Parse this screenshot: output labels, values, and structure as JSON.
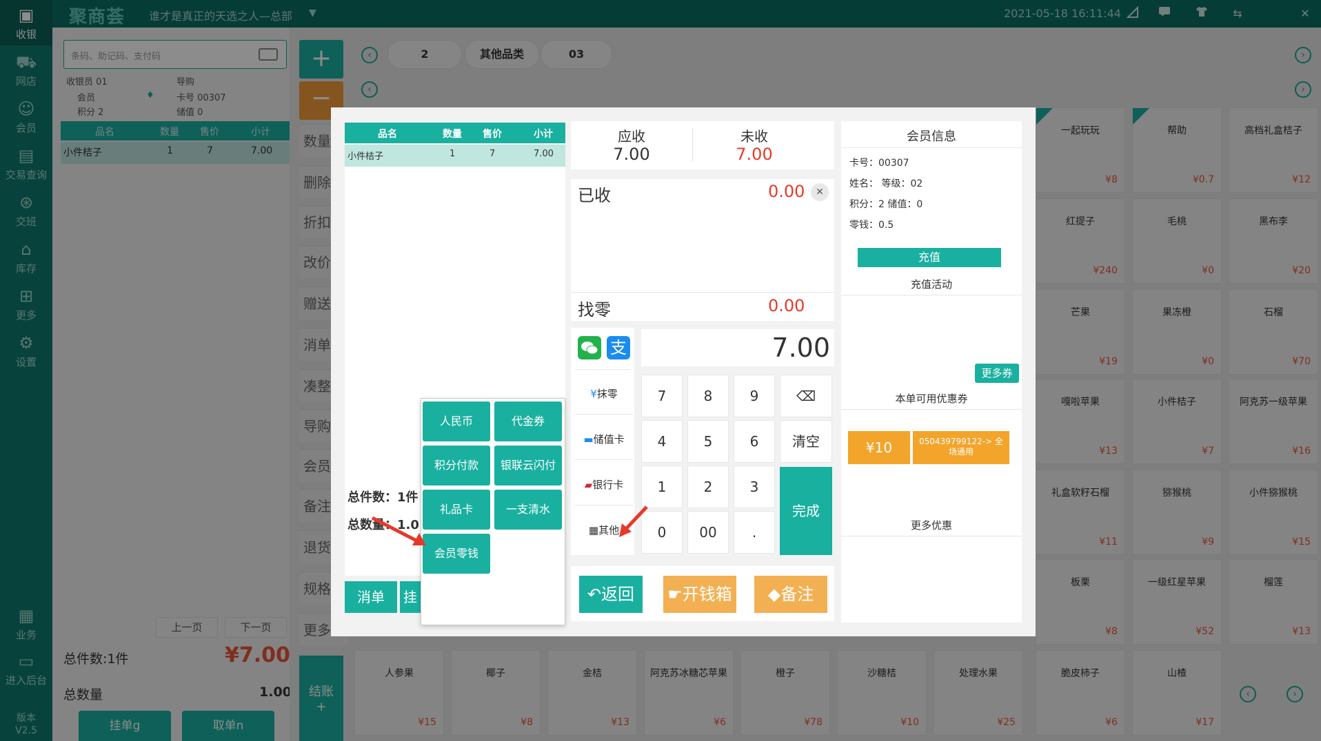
{
  "topbar": {
    "logo": "聚商荟",
    "shop_name": "谁才是真正的天选之人—总部",
    "datetime": "2021-05-18 16:11:44"
  },
  "sidebar": {
    "items": [
      {
        "label": "收银",
        "icon": "cashier-icon"
      },
      {
        "label": "网店",
        "icon": "online-store-icon"
      },
      {
        "label": "会员",
        "icon": "member-icon"
      },
      {
        "label": "交易查询",
        "icon": "transaction-query-icon"
      },
      {
        "label": "交班",
        "icon": "shift-handover-icon"
      },
      {
        "label": "库存",
        "icon": "inventory-icon"
      },
      {
        "label": "更多",
        "icon": "more-grid-icon"
      },
      {
        "label": "设置",
        "icon": "settings-gear-icon"
      },
      {
        "label": "业务",
        "icon": "business-icon"
      },
      {
        "label": "进入后台",
        "icon": "backend-icon"
      }
    ],
    "version_label": "版本",
    "version": "V2.5"
  },
  "left_panel": {
    "search_placeholder": "条码、助记码、支付码",
    "info": {
      "cashier_label": "收银员",
      "cashier": "01",
      "guide_label": "导购",
      "member_label": "会员",
      "card_label": "卡号",
      "card": "00307",
      "points_label": "积分",
      "points": "2",
      "stored_label": "储值",
      "stored": "0"
    },
    "table_headers": [
      "品名",
      "数量",
      "售价",
      "小计"
    ],
    "rows": [
      {
        "name": "小件桔子",
        "qty": "1",
        "price": "7",
        "subtotal": "7.00"
      }
    ],
    "prev_page": "上一页",
    "next_page": "下一页",
    "total_items_label": "总件数:1件",
    "total_amount": "¥7.00",
    "total_qty_label": "总数量",
    "total_qty": "1.00",
    "hold_button": "挂单g",
    "retrieve_button": "取单n"
  },
  "side_ops": {
    "labels": [
      "数量",
      "删除",
      "折扣",
      "改价",
      "赠送",
      "消单",
      "凑整",
      "导购",
      "会员",
      "备注",
      "退货",
      "规格",
      "更多"
    ],
    "settle": "结账",
    "settle_sub": "+"
  },
  "categories": {
    "tabs": [
      "2",
      "其他品类",
      "03"
    ]
  },
  "products": [
    {
      "name": "一起玩玩",
      "price": "¥8",
      "new": true
    },
    {
      "name": "帮助",
      "price": "¥0.7",
      "new": true
    },
    {
      "name": "高档礼盒桔子",
      "price": "¥12"
    },
    {
      "name": "红提子",
      "price": "¥240"
    },
    {
      "name": "毛桃",
      "price": "¥0"
    },
    {
      "name": "黑布李",
      "price": "¥20"
    },
    {
      "name": "芒果",
      "price": "¥19"
    },
    {
      "name": "果冻橙",
      "price": "¥0"
    },
    {
      "name": "石榴",
      "price": "¥70"
    },
    {
      "name": "嘎啦苹果",
      "price": "¥13"
    },
    {
      "name": "小件桔子",
      "price": "¥7"
    },
    {
      "name": "阿克苏一级苹果",
      "price": "¥16"
    },
    {
      "name": "礼盒软籽石榴",
      "price": "¥11"
    },
    {
      "name": "猕猴桃",
      "price": "¥9"
    },
    {
      "name": "小件猕猴桃",
      "price": "¥15"
    },
    {
      "name": "板栗",
      "price": "¥8"
    },
    {
      "name": "一级红星苹果",
      "price": "¥52"
    },
    {
      "name": "榴莲",
      "price": "¥13"
    }
  ],
  "bottom_products": [
    {
      "name": "人参果",
      "price": "¥15"
    },
    {
      "name": "椰子",
      "price": "¥8"
    },
    {
      "name": "金桔",
      "price": "¥13"
    },
    {
      "name": "阿克苏冰糖芯苹果",
      "price": "¥6"
    },
    {
      "name": "橙子",
      "price": "¥78"
    },
    {
      "name": "沙糖桔",
      "price": "¥10"
    },
    {
      "name": "处理水果",
      "price": "¥25"
    },
    {
      "name": "脆皮柿子",
      "price": "¥6"
    },
    {
      "name": "山楂",
      "price": "¥17"
    }
  ],
  "payment_modal": {
    "order_headers": [
      "品名",
      "数量",
      "售价",
      "小计"
    ],
    "order_rows": [
      {
        "name": "小件桔子",
        "qty": "1",
        "price": "7",
        "subtotal": "7.00"
      }
    ],
    "total_items": "总件数：1件",
    "total_qty": "总数量：1.0",
    "void_button": "消单",
    "hold_partial": "挂",
    "receivable_label": "应收",
    "receivable": "7.00",
    "unpaid_label": "未收",
    "unpaid": "7.00",
    "received_label": "已收",
    "received": "0.00",
    "change_label": "找零",
    "change": "0.00",
    "input_amount": "7.00",
    "pay_methods": [
      {
        "label": "抹零",
        "icon": "yen-round-icon"
      },
      {
        "label": "储值卡",
        "icon": "stored-card-icon"
      },
      {
        "label": "银行卡",
        "icon": "unionpay-icon"
      },
      {
        "label": "其他",
        "icon": "grid-four-icon"
      }
    ],
    "keypad": {
      "keys": [
        "7",
        "8",
        "9",
        "4",
        "5",
        "6",
        "1",
        "2",
        "3",
        "0",
        "00",
        "."
      ],
      "clear": "清空",
      "done": "完成"
    },
    "popup_options": [
      "人民币",
      "代金券",
      "积分付款",
      "银联云闪付",
      "礼品卡",
      "一支清水",
      "会员零钱"
    ],
    "back_button": "返回",
    "cash_drawer_button": "开钱箱",
    "note_button": "备注",
    "member": {
      "title": "会员信息",
      "card_line": "卡号：00307",
      "name_line": "姓名：   等级：02",
      "points_line": "积分：2  储值：0",
      "change_line": "零钱：0.5",
      "recharge_button": "充值",
      "recharge_activity": "充值活动",
      "more_coupons": "更多券",
      "coupons_title": "本单可用优惠券",
      "coupon_amount": "¥10",
      "coupon_desc": "050439799122-> 全场通用",
      "more_offers": "更多优惠"
    }
  },
  "colors": {
    "brand_teal": "#1ab0a0",
    "dark_teal": "#0e7a6e",
    "orange": "#f39c3b",
    "price_red": "#e8553a",
    "arrow_red": "#e53a2a"
  }
}
